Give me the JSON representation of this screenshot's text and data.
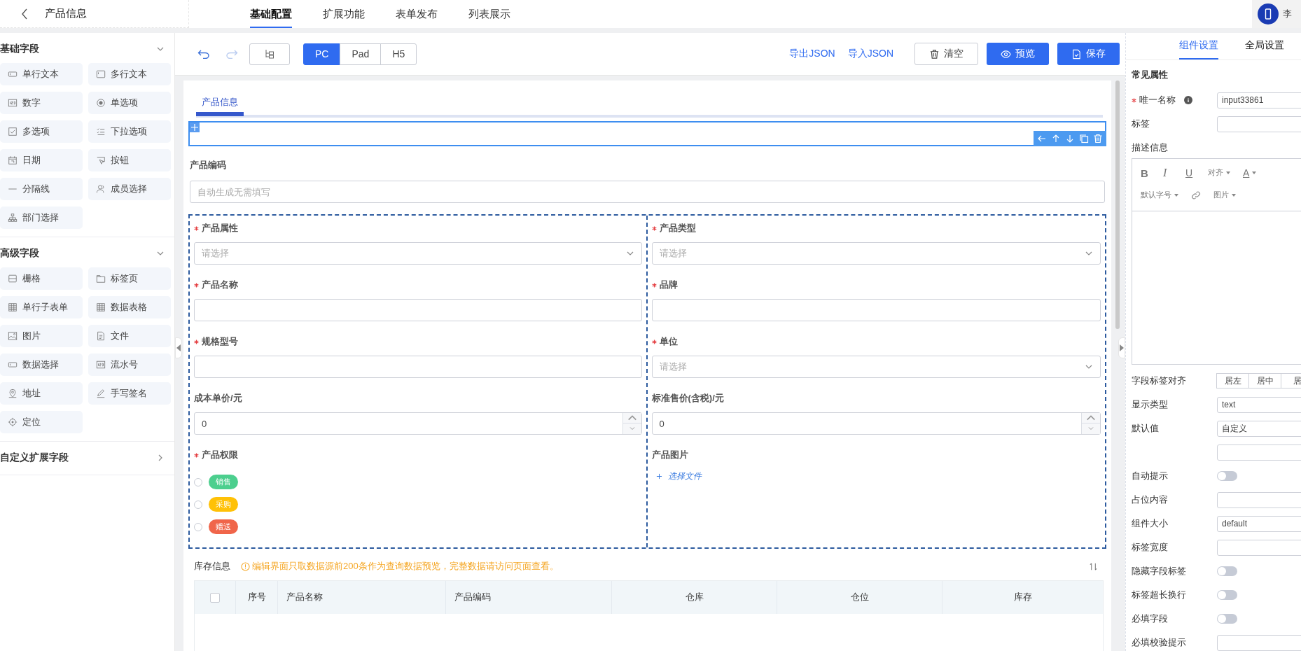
{
  "header": {
    "title": "产品信息",
    "tabs": [
      {
        "label": "基础配置",
        "selected": true
      },
      {
        "label": "扩展功能",
        "selected": false
      },
      {
        "label": "表单发布",
        "selected": false
      },
      {
        "label": "列表展示",
        "selected": false
      }
    ],
    "user": {
      "name": "李"
    }
  },
  "sidebar": {
    "sections": [
      {
        "title": "基础字段",
        "expanded": true,
        "items": [
          "单行文本",
          "多行文本",
          "数字",
          "单选项",
          "多选项",
          "下拉选项",
          "日期",
          "按钮",
          "分隔线",
          "成员选择",
          "部门选择"
        ]
      },
      {
        "title": "高级字段",
        "expanded": true,
        "items": [
          "栅格",
          "标签页",
          "单行子表单",
          "数据表格",
          "图片",
          "文件",
          "数据选择",
          "流水号",
          "地址",
          "手写签名",
          "定位"
        ]
      },
      {
        "title": "自定义扩展字段",
        "expanded": false
      }
    ]
  },
  "toolbar": {
    "history": [
      {
        "kind": "undo",
        "disabled": false
      },
      {
        "kind": "redo",
        "disabled": true
      }
    ],
    "devices": [
      {
        "label": "PC",
        "selected": true
      },
      {
        "label": "Pad",
        "selected": false
      },
      {
        "label": "H5",
        "selected": false
      }
    ],
    "links": [
      "导出JSON",
      "导入JSON"
    ],
    "buttons": [
      {
        "label": "清空",
        "kind": "clear"
      },
      {
        "label": "预览",
        "kind": "preview"
      },
      {
        "label": "保存",
        "kind": "save"
      }
    ]
  },
  "form": {
    "tabs": [
      {
        "label": "产品信息",
        "selected": true
      }
    ],
    "drop_zone": {
      "selected": true
    },
    "code_field": {
      "label": "产品编码",
      "placeholder": "自动生成无需填写"
    },
    "columns": [
      [
        {
          "label": "产品属性",
          "required": true,
          "kind": "select",
          "placeholder": "请选择"
        },
        {
          "label": "产品名称",
          "required": true,
          "kind": "input"
        },
        {
          "label": "规格型号",
          "required": true,
          "kind": "input"
        },
        {
          "label": "成本单价/元",
          "required": false,
          "kind": "number",
          "value": "0"
        },
        {
          "label": "产品权限",
          "required": true,
          "kind": "tags",
          "options": [
            {
              "label": "销售",
              "color": "#4ccf8e",
              "selected": false
            },
            {
              "label": "采购",
              "color": "#ffc107",
              "selected": false
            },
            {
              "label": "赠送",
              "color": "#f0654a",
              "selected": false
            }
          ]
        }
      ],
      [
        {
          "label": "产品类型",
          "required": true,
          "kind": "select",
          "placeholder": "请选择"
        },
        {
          "label": "品牌",
          "required": true,
          "kind": "input"
        },
        {
          "label": "单位",
          "required": true,
          "kind": "select",
          "placeholder": "请选择"
        },
        {
          "label": "标准售价(含税)/元",
          "required": false,
          "kind": "number",
          "value": "0"
        },
        {
          "label": "产品图片",
          "required": false,
          "kind": "upload",
          "action": "选择文件"
        }
      ]
    ],
    "stock": {
      "title": "库存信息",
      "notice": "编辑界面只取数据源前200条作为查询数据预览，完整数据请访问页面查看。",
      "table": {
        "select_all": {
          "checked": false
        },
        "columns": [
          "序号",
          "产品名称",
          "产品编码",
          "仓库",
          "仓位",
          "库存"
        ]
      }
    }
  },
  "settings": {
    "tabs": [
      {
        "label": "组件设置",
        "selected": true
      },
      {
        "label": "全局设置",
        "selected": false
      }
    ],
    "heading": "常见属性",
    "rows": [
      {
        "kind": "input",
        "label": "唯一名称",
        "required": true,
        "info": true,
        "value": "input33861"
      },
      {
        "kind": "input",
        "label": "标签"
      },
      {
        "kind": "editor",
        "label": "描述信息",
        "toolbar_rows": [
          [
            {
              "kind": "bold",
              "text": "B"
            },
            {
              "kind": "italic",
              "text": "I"
            },
            {
              "kind": "underline",
              "text": "U"
            },
            {
              "kind": "menu",
              "text": "对齐"
            },
            {
              "kind": "color",
              "text": "A"
            }
          ],
          [
            {
              "kind": "menu",
              "text": "默认字号"
            },
            {
              "kind": "link"
            },
            {
              "kind": "menu",
              "text": "图片"
            }
          ]
        ]
      },
      {
        "kind": "segmented",
        "label": "字段标签对齐",
        "options": [
          "居左",
          "居中",
          "居"
        ]
      },
      {
        "kind": "input",
        "label": "显示类型",
        "value": "text"
      },
      {
        "kind": "input",
        "label": "默认值",
        "value": "自定义"
      },
      {
        "kind": "input"
      },
      {
        "kind": "toggle",
        "label": "自动提示",
        "on": false
      },
      {
        "kind": "input",
        "label": "占位内容"
      },
      {
        "kind": "input",
        "label": "组件大小",
        "value": "default"
      },
      {
        "kind": "input",
        "label": "标签宽度"
      },
      {
        "kind": "toggle",
        "label": "隐藏字段标签",
        "on": false
      },
      {
        "kind": "toggle",
        "label": "标签超长换行",
        "on": false
      },
      {
        "kind": "toggle",
        "label": "必填字段",
        "on": false
      },
      {
        "kind": "input",
        "label": "必填校验提示"
      }
    ]
  }
}
